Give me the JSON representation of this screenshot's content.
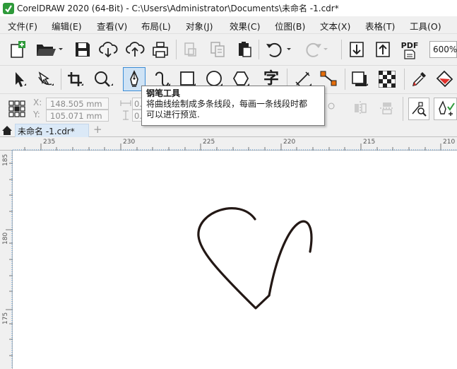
{
  "window": {
    "title": "CorelDRAW 2020 (64-Bit) - C:\\Users\\Administrator\\Documents\\未命名 -1.cdr*"
  },
  "menu": [
    {
      "label": "文件(F)"
    },
    {
      "label": "编辑(E)"
    },
    {
      "label": "查看(V)"
    },
    {
      "label": "布局(L)"
    },
    {
      "label": "对象(J)"
    },
    {
      "label": "效果(C)"
    },
    {
      "label": "位图(B)"
    },
    {
      "label": "文本(X)"
    },
    {
      "label": "表格(T)"
    },
    {
      "label": "工具(O)"
    }
  ],
  "standard_toolbar": {
    "pdf_label": "PDF",
    "zoom_value": "600%",
    "icons": [
      "new-document-icon",
      "open-folder-icon",
      "save-icon",
      "download-cloud-icon",
      "upload-cloud-icon",
      "print-icon",
      "cut-icon",
      "copy-icon",
      "paste-icon",
      "undo-icon",
      "redo-icon",
      "import-icon",
      "export-icon",
      "publish-pdf-icon"
    ]
  },
  "toolbox": {
    "active_tool": "pen-tool",
    "text_tool_glyph": "字",
    "icons": [
      "pick-tool-icon",
      "shape-tool-icon",
      "crop-tool-icon",
      "zoom-tool-icon",
      "pen-tool-icon",
      "bspline-tool-icon",
      "rectangle-tool-icon",
      "ellipse-tool-icon",
      "polygon-tool-icon",
      "text-tool-icon",
      "dimension-tool-icon",
      "connector-tool-icon",
      "drop-shadow-tool-icon",
      "transparency-tool-icon",
      "eyedropper-tool-icon",
      "interactive-fill-icon"
    ]
  },
  "property_bar": {
    "x_label": "X:",
    "y_label": "Y:",
    "x_value": "148.505 mm",
    "y_value": "105.071 mm",
    "width_partial": "0.",
    "height_partial": "0."
  },
  "tooltip": {
    "title": "钢笔工具",
    "line1": "将曲线绘制成多条线段，每画一条线段时都",
    "line2": "可以进行预览."
  },
  "document_tab": {
    "label": "未命名 -1.cdr*",
    "add_label": "+"
  },
  "ruler_top": {
    "labels": [
      "235",
      "230",
      "225",
      "220",
      "215",
      "210"
    ]
  },
  "ruler_left": {
    "labels": [
      "185",
      "180",
      "175"
    ]
  },
  "colors": {
    "accent": "#3b8dd6",
    "app_logo_green": "#2e9a3a",
    "tab_background": "#dbe9f7",
    "toolbar_background": "#f0f0f0",
    "heart_stroke": "#231815"
  }
}
